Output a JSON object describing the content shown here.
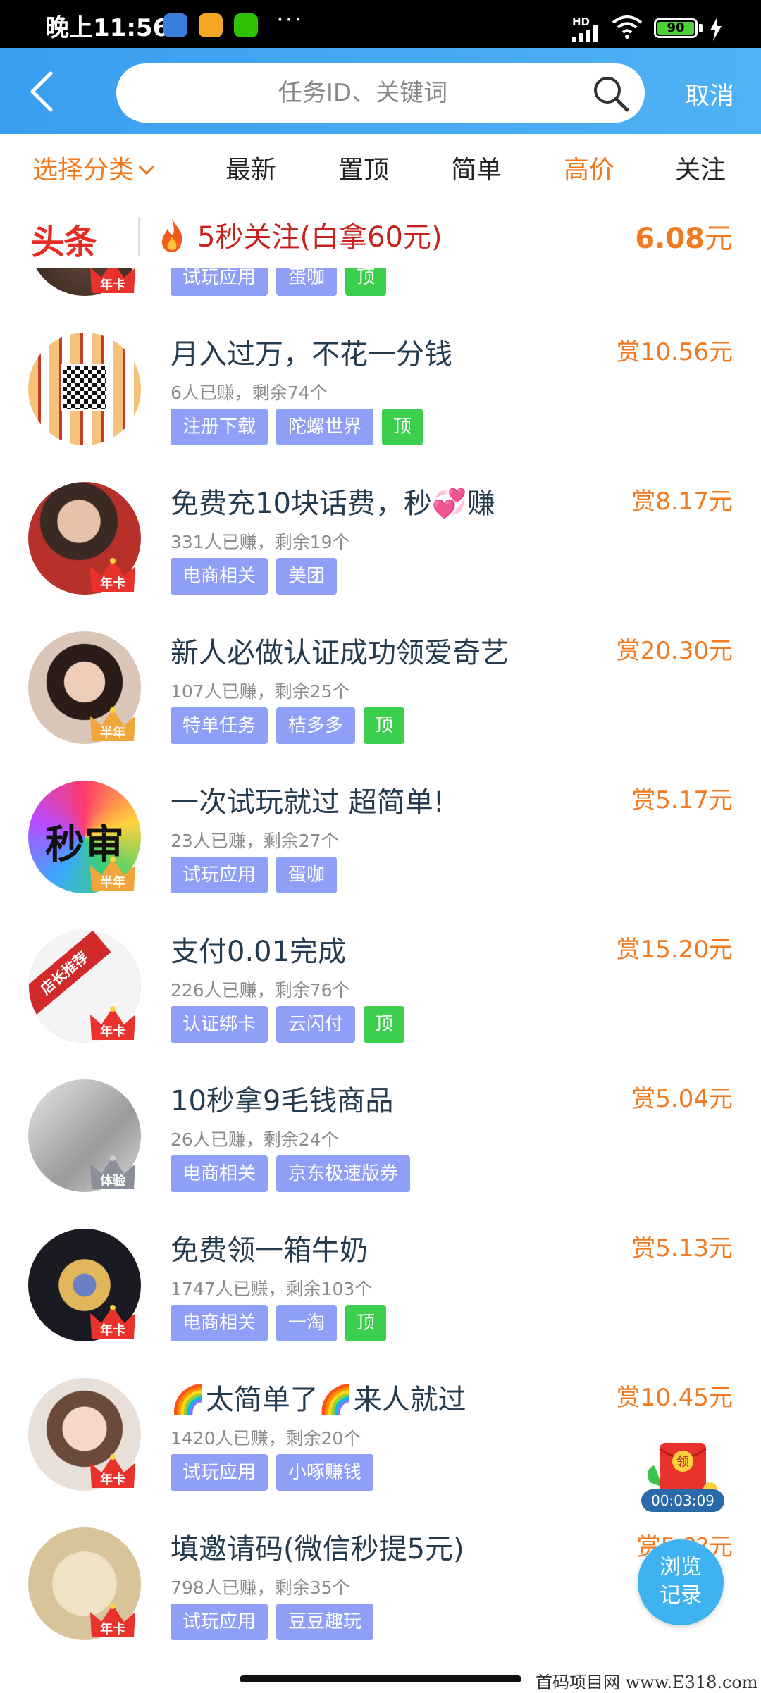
{
  "status_bar": {
    "time": "晚上11:56",
    "network": "HD",
    "battery": "90"
  },
  "header": {
    "search_placeholder": "任务ID、关键词",
    "cancel_label": "取消"
  },
  "tabs": [
    {
      "label": "选择分类",
      "active": true
    },
    {
      "label": "最新"
    },
    {
      "label": "置顶"
    },
    {
      "label": "简单"
    },
    {
      "label": "高价",
      "highlight": true
    },
    {
      "label": "关注"
    }
  ],
  "headline": {
    "logo": "头条",
    "text": "5秒关注(白拿60元)",
    "price": "6.08",
    "unit": "元"
  },
  "partial_item": {
    "badge": "年卡",
    "tags": [
      "试玩应用",
      "蛋咖"
    ],
    "top_tag": "顶"
  },
  "items": [
    {
      "title": "月入过万，不花一分钱",
      "stat": "6人已赚，剩余74个",
      "price": "赏10.56元",
      "tags": [
        "注册下载",
        "陀螺世界"
      ],
      "top": "顶",
      "badge": ""
    },
    {
      "title": "免费充10块话费，秒💞赚",
      "stat": "331人已赚，剩余19个",
      "price": "赏8.17元",
      "tags": [
        "电商相关",
        "美团"
      ],
      "top": "",
      "badge": "年卡"
    },
    {
      "title": "新人必做认证成功领爱奇艺",
      "stat": "107人已赚，剩余25个",
      "price": "赏20.30元",
      "tags": [
        "特单任务",
        "桔多多"
      ],
      "top": "顶",
      "badge": "半年"
    },
    {
      "title": "一次试玩就过 超简单!",
      "stat": "23人已赚，剩余27个",
      "price": "赏5.17元",
      "tags": [
        "试玩应用",
        "蛋咖"
      ],
      "top": "",
      "badge": "半年"
    },
    {
      "title": "支付0.01完成",
      "stat": "226人已赚，剩余76个",
      "price": "赏15.20元",
      "tags": [
        "认证绑卡",
        "云闪付"
      ],
      "top": "顶",
      "badge": "年卡"
    },
    {
      "title": "10秒拿9毛钱商品",
      "stat": "26人已赚，剩余24个",
      "price": "赏5.04元",
      "tags": [
        "电商相关",
        "京东极速版券"
      ],
      "top": "",
      "badge": "体验"
    },
    {
      "title": "免费领一箱牛奶",
      "stat": "1747人已赚，剩余103个",
      "price": "赏5.13元",
      "tags": [
        "电商相关",
        "一淘"
      ],
      "top": "顶",
      "badge": "年卡"
    },
    {
      "title": "🌈太简单了🌈来人就过",
      "stat": "1420人已赚，剩余20个",
      "price": "赏10.45元",
      "tags": [
        "试玩应用",
        "小啄赚钱"
      ],
      "top": "",
      "badge": "年卡"
    },
    {
      "title": "填邀请码(微信秒提5元)",
      "stat": "798人已赚，剩余35个",
      "price": "赏5.??元",
      "tags": [
        "试玩应用",
        "豆豆趣玩"
      ],
      "top": "",
      "badge": "年卡"
    }
  ],
  "avatar_text": {
    "seckill": "秒审",
    "shop": "店长推荐"
  },
  "floating": {
    "redpack_label": "领",
    "timer": "00:03:09",
    "history_line1": "浏览",
    "history_line2": "记录"
  },
  "watermark": "首码项目网 www.E318.com",
  "colors": {
    "accent": "#f2791e",
    "header": "#3a9ef0",
    "tag": "#8f9ff7",
    "top_tag": "#3ccf4e",
    "headline_red": "#c8211c"
  }
}
